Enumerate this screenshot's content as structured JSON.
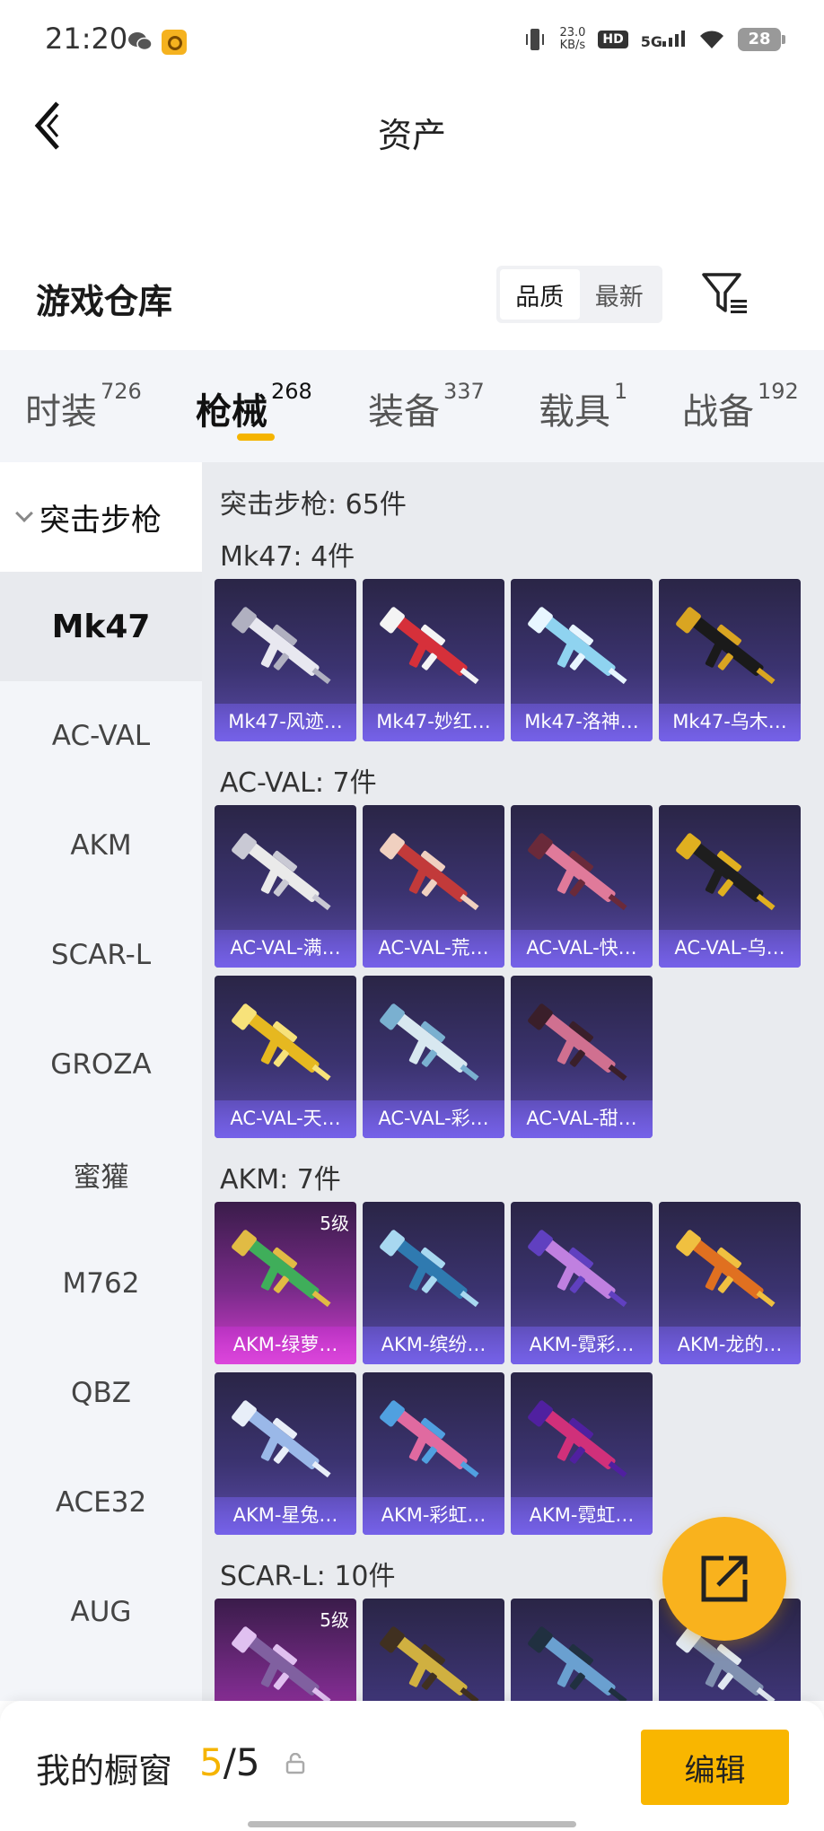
{
  "status": {
    "time": "21:20",
    "speed_top": "23.0",
    "speed_unit": "KB/s",
    "hd": "HD",
    "net": "5G",
    "battery": "28"
  },
  "header": {
    "title": "资产"
  },
  "warehouse": {
    "title": "游戏仓库",
    "sort_options": [
      "品质",
      "最新"
    ]
  },
  "tabs": [
    {
      "label": "时装",
      "count": "726"
    },
    {
      "label": "枪械",
      "count": "268"
    },
    {
      "label": "装备",
      "count": "337"
    },
    {
      "label": "载具",
      "count": "1"
    },
    {
      "label": "战备",
      "count": "192"
    }
  ],
  "sidebar": {
    "group": "突击步枪",
    "items": [
      "Mk47",
      "AC-VAL",
      "AKM",
      "SCAR-L",
      "GROZA",
      "蜜獾",
      "M762",
      "QBZ",
      "ACE32",
      "AUG"
    ]
  },
  "content": {
    "summary": "突击步枪: 65件",
    "sections": [
      {
        "title": "Mk47: 4件",
        "items": [
          {
            "name": "Mk47-风迹…",
            "level": ""
          },
          {
            "name": "Mk47-妙红…",
            "level": ""
          },
          {
            "name": "Mk47-洛神…",
            "level": ""
          },
          {
            "name": "Mk47-乌木…",
            "level": ""
          }
        ]
      },
      {
        "title": "AC-VAL: 7件",
        "items": [
          {
            "name": "AC-VAL-满…",
            "level": ""
          },
          {
            "name": "AC-VAL-荒…",
            "level": ""
          },
          {
            "name": "AC-VAL-快…",
            "level": ""
          },
          {
            "name": "AC-VAL-乌…",
            "level": ""
          },
          {
            "name": "AC-VAL-天…",
            "level": ""
          },
          {
            "name": "AC-VAL-彩…",
            "level": ""
          },
          {
            "name": "AC-VAL-甜…",
            "level": ""
          }
        ]
      },
      {
        "title": "AKM: 7件",
        "items": [
          {
            "name": "AKM-绿萝…",
            "level": "5级"
          },
          {
            "name": "AKM-缤纷…",
            "level": ""
          },
          {
            "name": "AKM-霓彩…",
            "level": ""
          },
          {
            "name": "AKM-龙的…",
            "level": ""
          },
          {
            "name": "AKM-星兔…",
            "level": ""
          },
          {
            "name": "AKM-彩虹…",
            "level": ""
          },
          {
            "name": "AKM-霓虹…",
            "level": ""
          }
        ]
      },
      {
        "title": "SCAR-L: 10件",
        "items": [
          {
            "name": "",
            "level": "5级"
          },
          {
            "name": "",
            "level": ""
          },
          {
            "name": "",
            "level": ""
          },
          {
            "name": "",
            "level": ""
          }
        ]
      }
    ]
  },
  "bottom": {
    "showcase_label": "我的橱窗",
    "showcase_current": "5",
    "showcase_sep": "/",
    "showcase_total": "5",
    "edit_label": "编辑"
  },
  "colors": {
    "accent": "#f9b600",
    "card_purple": "#3b3370",
    "card_gold": "#d43dcf"
  }
}
